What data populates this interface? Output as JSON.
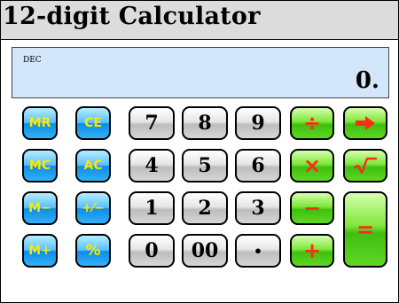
{
  "window": {
    "title": "12-digit Calculator"
  },
  "display": {
    "mode": "DEC",
    "value": "0."
  },
  "memory_keys": {
    "mr": "MR",
    "mc": "MC",
    "mminus": "M−",
    "mplus": "M+"
  },
  "clear_keys": {
    "ce": "CE",
    "ac": "AC",
    "sign": "+⁄−",
    "percent": "%"
  },
  "digits": {
    "d7": "7",
    "d8": "8",
    "d9": "9",
    "d4": "4",
    "d5": "5",
    "d6": "6",
    "d1": "1",
    "d2": "2",
    "d3": "3",
    "d0": "0",
    "d00": "00",
    "dot": "•"
  },
  "operators": {
    "divide": "÷",
    "multiply": "×",
    "minus": "−",
    "plus": "+",
    "equals": "="
  },
  "icons": {
    "arrow": "right-arrow-icon",
    "sqrt": "square-root-icon"
  },
  "colors": {
    "title_bar": "#dcdcdc",
    "display_bg": "#d3e6fa",
    "blue_key": "#2aa8f5",
    "blue_key_text": "#ffe600",
    "gray_key": "#d9d9d9",
    "green_key": "#60d624",
    "green_key_text": "#ff2a1a"
  }
}
